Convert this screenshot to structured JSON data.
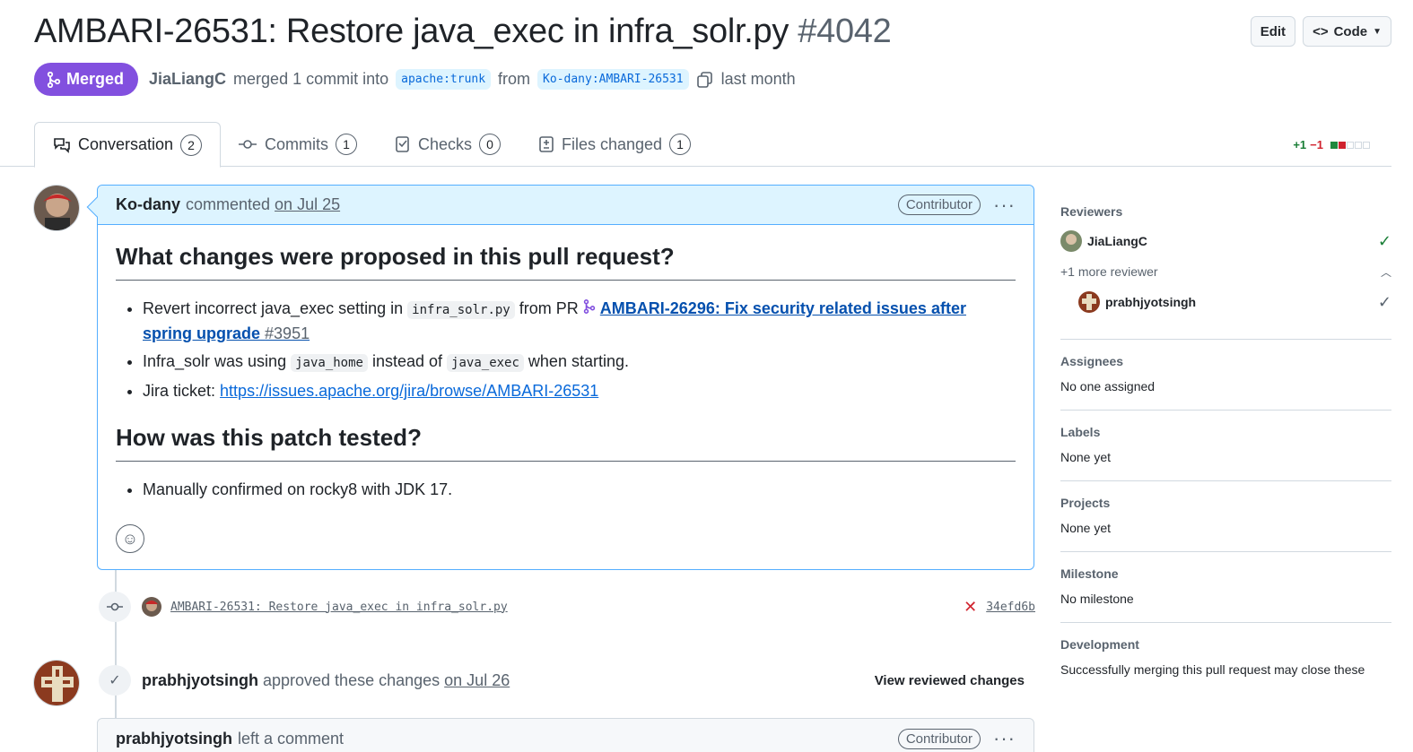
{
  "header": {
    "title": "AMBARI-26531: Restore java_exec in infra_solr.py",
    "number": "#4042",
    "edit_label": "Edit",
    "code_label": "Code"
  },
  "meta": {
    "state": "Merged",
    "author": "JiaLiangC",
    "action": "merged 1 commit into",
    "base_branch": "apache:trunk",
    "from_word": "from",
    "head_branch": "Ko-dany:AMBARI-26531",
    "time": "last month"
  },
  "tabs": [
    {
      "label": "Conversation",
      "count": "2"
    },
    {
      "label": "Commits",
      "count": "1"
    },
    {
      "label": "Checks",
      "count": "0"
    },
    {
      "label": "Files changed",
      "count": "1"
    }
  ],
  "diffstat": {
    "additions": "+1",
    "deletions": "−1",
    "colors": {
      "add": "#1f883d",
      "del": "#cf222e"
    }
  },
  "comment": {
    "author": "Ko-dany",
    "action": "commented",
    "date": "on Jul 25",
    "role": "Contributor",
    "h1": "What changes were proposed in this pull request?",
    "bullet1_pre": "Revert incorrect java_exec setting in",
    "bullet1_code": "infra_solr.py",
    "bullet1_mid": "from PR",
    "bullet1_link": "AMBARI-26296: Fix security related issues after spring upgrade",
    "bullet1_num": "#3951",
    "bullet2_pre": "Infra_solr was using",
    "bullet2_code1": "java_home",
    "bullet2_mid": "instead of",
    "bullet2_code2": "java_exec",
    "bullet2_post": "when starting.",
    "bullet3_pre": "Jira ticket:",
    "bullet3_link": "https://issues.apache.org/jira/browse/AMBARI-26531",
    "h2": "How was this patch tested?",
    "bullet4": "Manually confirmed on rocky8 with JDK 17."
  },
  "commit": {
    "message": "AMBARI-26531: Restore java_exec in infra_solr.py",
    "sha": "34efd6b"
  },
  "review": {
    "author": "prabhjyotsingh",
    "action": "approved these changes",
    "date": "on Jul 26",
    "view_label": "View reviewed changes"
  },
  "comment2": {
    "author": "prabhjyotsingh",
    "action": "left a comment",
    "role": "Contributor"
  },
  "sidebar": {
    "reviewers_title": "Reviewers",
    "reviewer1": "JiaLiangC",
    "more_reviewers": "+1 more reviewer",
    "reviewer2": "prabhjyotsingh",
    "assignees_title": "Assignees",
    "assignees_value": "No one assigned",
    "labels_title": "Labels",
    "labels_value": "None yet",
    "projects_title": "Projects",
    "projects_value": "None yet",
    "milestone_title": "Milestone",
    "milestone_value": "No milestone",
    "development_title": "Development",
    "development_value": "Successfully merging this pull request may close these"
  }
}
